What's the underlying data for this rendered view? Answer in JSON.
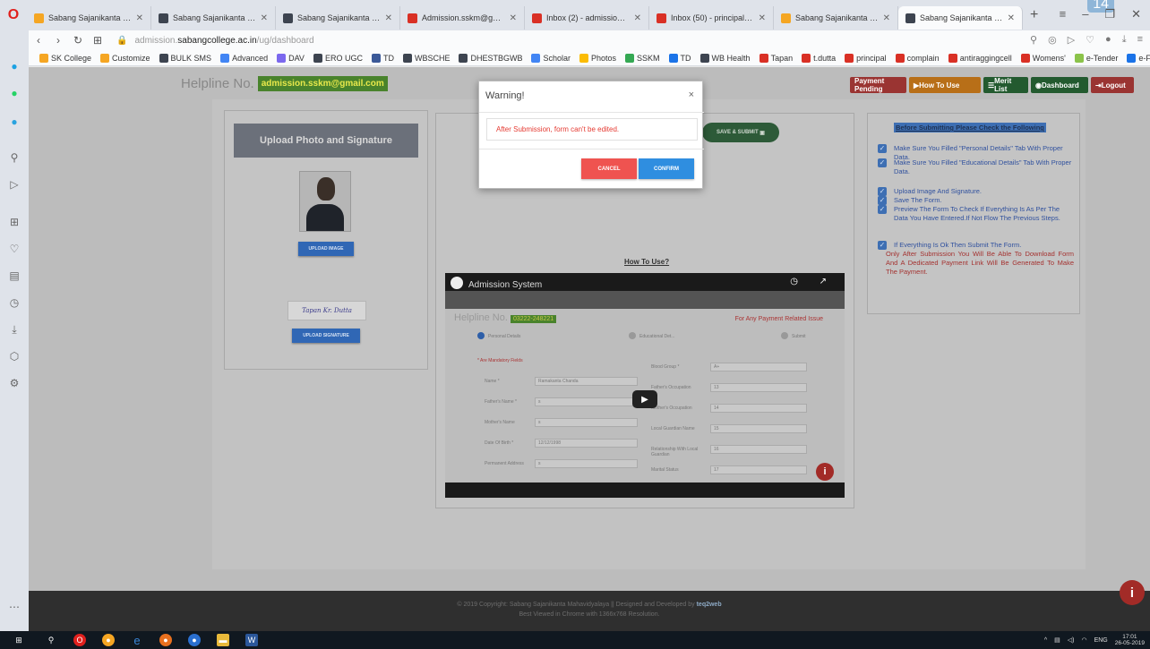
{
  "browser": {
    "corner_number": "14",
    "tabs": [
      {
        "title": "Sabang Sajanikanta Maha",
        "fav": "#f5a623"
      },
      {
        "title": "Sabang Sajanikanta Maha",
        "fav": "#3d4450"
      },
      {
        "title": "Sabang Sajanikanta Maha",
        "fav": "#3d4450"
      },
      {
        "title": "Admission.sskm@gmail.co",
        "fav": "#d93025"
      },
      {
        "title": "Inbox (2) - admission.sskm",
        "fav": "#d93025"
      },
      {
        "title": "Inbox (50) - principal.sskm",
        "fav": "#d93025"
      },
      {
        "title": "Sabang Sajanikanta Maha",
        "fav": "#f5a623"
      },
      {
        "title": "Sabang Sajanikanta Maha",
        "fav": "#3d4450"
      }
    ],
    "new_tab": "+",
    "url_dim": "admission.",
    "url_host": "sabangcollege.ac.in",
    "url_path": "/ug/dashboard",
    "bookmarks": [
      {
        "label": "SK College",
        "color": "#f5a623"
      },
      {
        "label": "Customize",
        "color": "#f5a623"
      },
      {
        "label": "BULK SMS",
        "color": "#3d4450"
      },
      {
        "label": "Advanced",
        "color": "#4285f4"
      },
      {
        "label": "DAV",
        "color": "#7b68ee"
      },
      {
        "label": "ERO UGC",
        "color": "#3d4450"
      },
      {
        "label": "TD",
        "color": "#3b5998"
      },
      {
        "label": "WBSCHE",
        "color": "#3d4450"
      },
      {
        "label": "DHESTBGWB",
        "color": "#3d4450"
      },
      {
        "label": "Scholar",
        "color": "#4285f4"
      },
      {
        "label": "Photos",
        "color": "#fbbc05"
      },
      {
        "label": "SSKM",
        "color": "#34a853"
      },
      {
        "label": "TD",
        "color": "#1a73e8"
      },
      {
        "label": "WB Health",
        "color": "#3d4450"
      },
      {
        "label": "Tapan",
        "color": "#d93025"
      },
      {
        "label": "t.dutta",
        "color": "#d93025"
      },
      {
        "label": "principal",
        "color": "#d93025"
      },
      {
        "label": "complain",
        "color": "#d93025"
      },
      {
        "label": "antiraggingcell",
        "color": "#d93025"
      },
      {
        "label": "Womens'",
        "color": "#d93025"
      },
      {
        "label": "e-Tender",
        "color": "#8bc34a"
      },
      {
        "label": "e-Filing",
        "color": "#1a73e8"
      }
    ],
    "bookmarks_more": "»"
  },
  "header": {
    "helpline_label": "Helpline No.",
    "helpline_email": "admission.sskm@gmail.com",
    "buttons": [
      {
        "label": "Payment Pending",
        "color": "#9a3432"
      },
      {
        "label": "How To Use",
        "color": "#b86f18"
      },
      {
        "label": "Merit List",
        "color": "#235a2f"
      },
      {
        "label": "Dashboard",
        "color": "#235a2f"
      },
      {
        "label": "Logout",
        "color": "#9a3432"
      }
    ]
  },
  "upload": {
    "title": "Upload Photo and Signature",
    "upload_image_label": "UPLOAD IMAGE",
    "signature_text": "Tapan Kr. Dutta",
    "upload_signature_label": "UPLOAD SIGNATURE"
  },
  "middle": {
    "save_submit_label": "SAVE & SUBMIT",
    "how_to_use_link": "How To Use?",
    "video": {
      "title": "Admission System",
      "helpline_label": "Helpline No.",
      "helpline_number": "03222-248221",
      "payment_issue": "For Any Payment Related Issue",
      "steps": [
        "Personal Details",
        "Educational Det...",
        "Submit"
      ],
      "mandatory_note": "* Are Mandatory Fields",
      "fields_left": [
        {
          "label": "Name *",
          "value": "Ramakanta Chanda"
        },
        {
          "label": "Father's Name *",
          "value": "s"
        },
        {
          "label": "Mother's Name",
          "value": "s"
        },
        {
          "label": "Date Of Birth *",
          "value": "12/12/1998"
        },
        {
          "label": "Permanent Address",
          "value": "s"
        }
      ],
      "fields_right": [
        {
          "label": "Blood Group *",
          "value": "A+"
        },
        {
          "label": "Father's Occupation",
          "value": "13"
        },
        {
          "label": "Mother's Occupation",
          "value": "14"
        },
        {
          "label": "Local Guardian Name",
          "value": "15"
        },
        {
          "label": "Relationship With Local Guardian",
          "value": "16"
        },
        {
          "label": "Marital Status",
          "value": "17"
        }
      ]
    }
  },
  "checklist": {
    "title": "Before Submitting Please Check the Following",
    "items": [
      "Make Sure You Filled \"Personal Details\" Tab With Proper Data.",
      "Make Sure You Filled \"Educational Details\" Tab With Proper Data.",
      "Upload Image And Signature.",
      "Save The Form.",
      "Preview The Form To Check If Everything Is As Per The Data You Have Entered.If Not Flow The Previous Steps.",
      "If Everything Is Ok Then Submit The Form."
    ],
    "note": "Only After Submission You Will Be Able To Download Form And A Dedicated Payment Link Will Be Generated To Make The Payment."
  },
  "footer": {
    "line1_prefix": "© 2019 Copyright: Sabang Sajanikanta Mahavidyalaya || Designed and Developed by ",
    "line1_brand": "teq2web",
    "line2": "Best Viewed in Chrome with 1366x768 Resolution."
  },
  "modal": {
    "title": "Warning!",
    "close": "×",
    "message": "After Submission, form can't be edited.",
    "cancel_label": "CANCEL",
    "confirm_label": "CONFIRM",
    "cancel_color": "#ef5350",
    "confirm_color": "#2f8ee0"
  },
  "taskbar": {
    "lang": "ENG",
    "time": "17:01",
    "date": "26-05-2019"
  },
  "info_icon": "i"
}
